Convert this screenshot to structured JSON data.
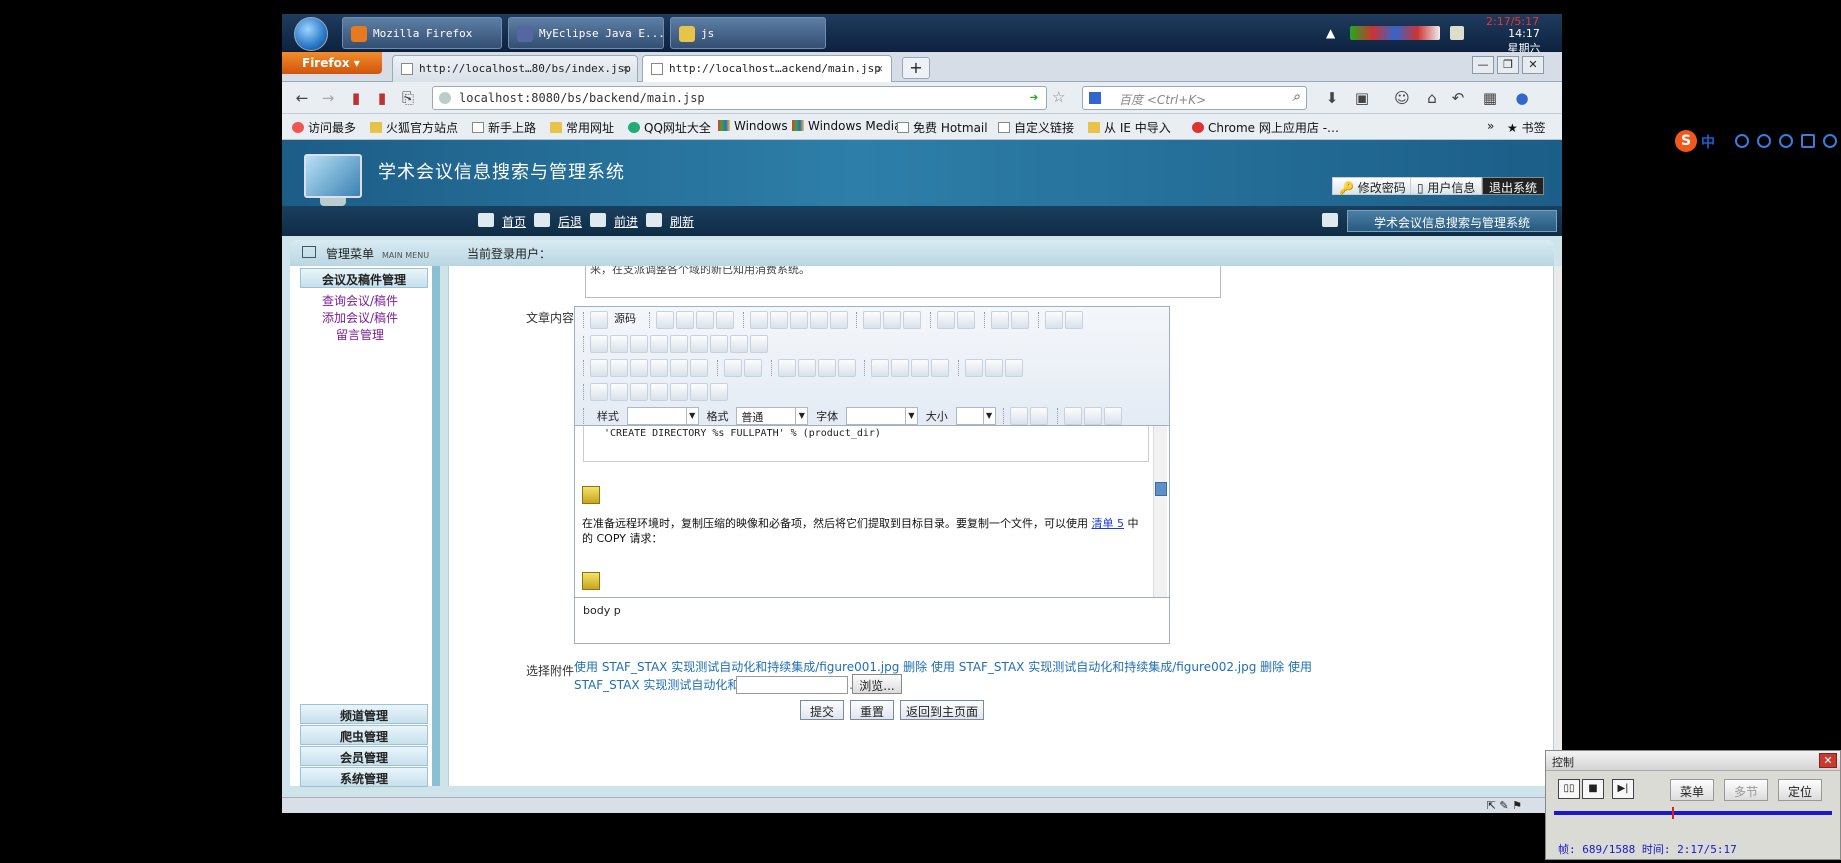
{
  "taskbar": {
    "tasks": [
      {
        "label": "Mozilla Firefox"
      },
      {
        "label": "MyEclipse Java E..."
      },
      {
        "label": "js"
      }
    ],
    "clock_red": "2:17/5:17",
    "time": "14:17",
    "weekday": "星期六"
  },
  "firefox": {
    "menu_button": "Firefox",
    "tabs": [
      {
        "label": "http://localhost…80/bs/index.jsp"
      },
      {
        "label": "http://localhost…ackend/main.jsp"
      }
    ],
    "url": "localhost:8080/bs/backend/main.jsp",
    "search_placeholder": "百度 <Ctrl+K>",
    "bookmarks": [
      "访问最多",
      "火狐官方站点",
      "新手上路",
      "常用网址",
      "QQ网址大全",
      "Windows",
      "Windows Media",
      "免费 Hotmail",
      "自定义链接",
      "从 IE 中导入",
      "Chrome 网上应用店 -…"
    ],
    "bookmarks_right": "书签"
  },
  "header": {
    "title": "学术会议信息搜索与管理系统",
    "buttons": {
      "change_password": "修改密码",
      "user_info": "用户信息",
      "logout": "退出系统"
    },
    "nav": {
      "home": "首页",
      "back": "后退",
      "forward": "前进",
      "refresh": "刷新"
    },
    "system_name": "学术会议信息搜索与管理系统"
  },
  "content_header": {
    "menu_title": "管理菜单",
    "menu_subtitle": "MAIN MENU",
    "current_user_label": "当前登录用户："
  },
  "sidebar": {
    "section": "会议及稿件管理",
    "links": [
      "查询会议/稿件",
      "添加会议/稿件",
      "留言管理"
    ],
    "bottom_sections": [
      "频道管理",
      "爬虫管理",
      "会员管理",
      "系统管理"
    ]
  },
  "form": {
    "top_text": "来，在支派调整各个域的新已知用消费系统。",
    "content_label": "文章内容",
    "toolbar": {
      "source_label": "源码",
      "style_label": "样式",
      "format_label": "格式",
      "format_value": "普通",
      "font_label": "字体",
      "size_label": "大小"
    },
    "code_line": "'CREATE DIRECTORY %s FULLPATH' % (product_dir)",
    "paragraph_before": "在准备远程环境时，复制压缩的映像和必备项，然后将它们提取到目标目录。要复制一个文件，可以使用 ",
    "paragraph_link": "清单 5",
    "paragraph_after": " 中的 COPY 请求：",
    "path": "body  p",
    "attach_label": "选择附件",
    "attachments": "使用 STAF_STAX 实现测试自动化和持续集成/figure001.jpg 删除    使用 STAF_STAX 实现测试自动化和持续集成/figure002.jpg 删除    使用 STAF_STAX 实现测试自动化和持续集成/figure003.jpg 删除",
    "browse": "浏览...",
    "submit": "提交",
    "reset": "重置",
    "back": "返回到主页面"
  },
  "control": {
    "title": "控制",
    "menu": "菜单",
    "multi": "多节",
    "locate": "定位",
    "info": "帧: 689/1588 时间: 2:17/5:17"
  },
  "ime": {
    "label": "中"
  },
  "colors": {
    "banner": "#2d7fa9",
    "link": "#1f6fb5",
    "sidebar_link": "#7a1f93"
  }
}
